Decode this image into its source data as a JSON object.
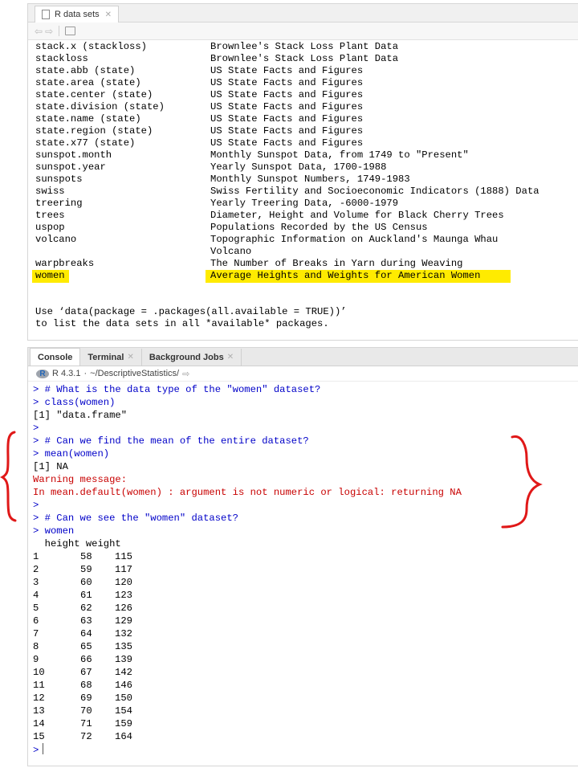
{
  "help_pane": {
    "tab_label": "R data sets",
    "rows": [
      {
        "name": "stack.x (stackloss)",
        "desc": "Brownlee's Stack Loss Plant Data"
      },
      {
        "name": "stackloss",
        "desc": "Brownlee's Stack Loss Plant Data"
      },
      {
        "name": "state.abb (state)",
        "desc": "US State Facts and Figures"
      },
      {
        "name": "state.area (state)",
        "desc": "US State Facts and Figures"
      },
      {
        "name": "state.center (state)",
        "desc": "US State Facts and Figures"
      },
      {
        "name": "state.division (state)",
        "desc": "US State Facts and Figures"
      },
      {
        "name": "state.name (state)",
        "desc": "US State Facts and Figures"
      },
      {
        "name": "state.region (state)",
        "desc": "US State Facts and Figures"
      },
      {
        "name": "state.x77 (state)",
        "desc": "US State Facts and Figures"
      },
      {
        "name": "sunspot.month",
        "desc": "Monthly Sunspot Data, from 1749 to \"Present\""
      },
      {
        "name": "sunspot.year",
        "desc": "Yearly Sunspot Data, 1700-1988"
      },
      {
        "name": "sunspots",
        "desc": "Monthly Sunspot Numbers, 1749-1983"
      },
      {
        "name": "swiss",
        "desc": "Swiss Fertility and Socioeconomic Indicators (1888) Data"
      },
      {
        "name": "treering",
        "desc": "Yearly Treering Data, -6000-1979"
      },
      {
        "name": "trees",
        "desc": "Diameter, Height and Volume for Black Cherry Trees"
      },
      {
        "name": "uspop",
        "desc": "Populations Recorded by the US Census"
      },
      {
        "name": "volcano",
        "desc": "Topographic Information on Auckland's Maunga Whau"
      },
      {
        "name": "",
        "desc": "Volcano"
      },
      {
        "name": "warpbreaks",
        "desc": "The Number of Breaks in Yarn during Weaving"
      },
      {
        "name": "women",
        "desc": "Average Heights and Weights for American Women",
        "highlight": true
      }
    ],
    "usage_line1": "Use ‘data(package = .packages(all.available = TRUE))’",
    "usage_line2": "to list the data sets in all *available* packages."
  },
  "console_pane": {
    "tabs": [
      {
        "label": "Console",
        "active": true,
        "closable": false
      },
      {
        "label": "Terminal",
        "active": false,
        "closable": true
      },
      {
        "label": "Background Jobs",
        "active": false,
        "closable": true
      }
    ],
    "r_version": "R 4.3.1",
    "separator": "·",
    "working_dir": "~/DescriptiveStatistics/",
    "lines": [
      {
        "type": "input",
        "text": "> # What is the data type of the \"women\" dataset?"
      },
      {
        "type": "input",
        "text": "> class(women)"
      },
      {
        "type": "output",
        "text": "[1] \"data.frame\""
      },
      {
        "type": "input",
        "text": ">"
      },
      {
        "type": "input",
        "text": "> # Can we find the mean of the entire dataset?"
      },
      {
        "type": "input",
        "text": "> mean(women)"
      },
      {
        "type": "output",
        "text": "[1] NA"
      },
      {
        "type": "warn",
        "text": "Warning message:"
      },
      {
        "type": "warn",
        "text": "In mean.default(women) : argument is not numeric or logical: returning NA"
      },
      {
        "type": "input",
        "text": ">"
      },
      {
        "type": "input",
        "text": "> # Can we see the \"women\" dataset?"
      },
      {
        "type": "input",
        "text": "> women"
      }
    ],
    "table_header": "  height weight",
    "table": [
      {
        "i": "1",
        "h": "58",
        "w": "115"
      },
      {
        "i": "2",
        "h": "59",
        "w": "117"
      },
      {
        "i": "3",
        "h": "60",
        "w": "120"
      },
      {
        "i": "4",
        "h": "61",
        "w": "123"
      },
      {
        "i": "5",
        "h": "62",
        "w": "126"
      },
      {
        "i": "6",
        "h": "63",
        "w": "129"
      },
      {
        "i": "7",
        "h": "64",
        "w": "132"
      },
      {
        "i": "8",
        "h": "65",
        "w": "135"
      },
      {
        "i": "9",
        "h": "66",
        "w": "139"
      },
      {
        "i": "10",
        "h": "67",
        "w": "142"
      },
      {
        "i": "11",
        "h": "68",
        "w": "146"
      },
      {
        "i": "12",
        "h": "69",
        "w": "150"
      },
      {
        "i": "13",
        "h": "70",
        "w": "154"
      },
      {
        "i": "14",
        "h": "71",
        "w": "159"
      },
      {
        "i": "15",
        "h": "72",
        "w": "164"
      }
    ],
    "prompt": ">"
  },
  "colors": {
    "highlight": "#ffeb00",
    "input_blue": "#0000c8",
    "warning_red": "#c80000",
    "annotation_red": "#e01818"
  }
}
